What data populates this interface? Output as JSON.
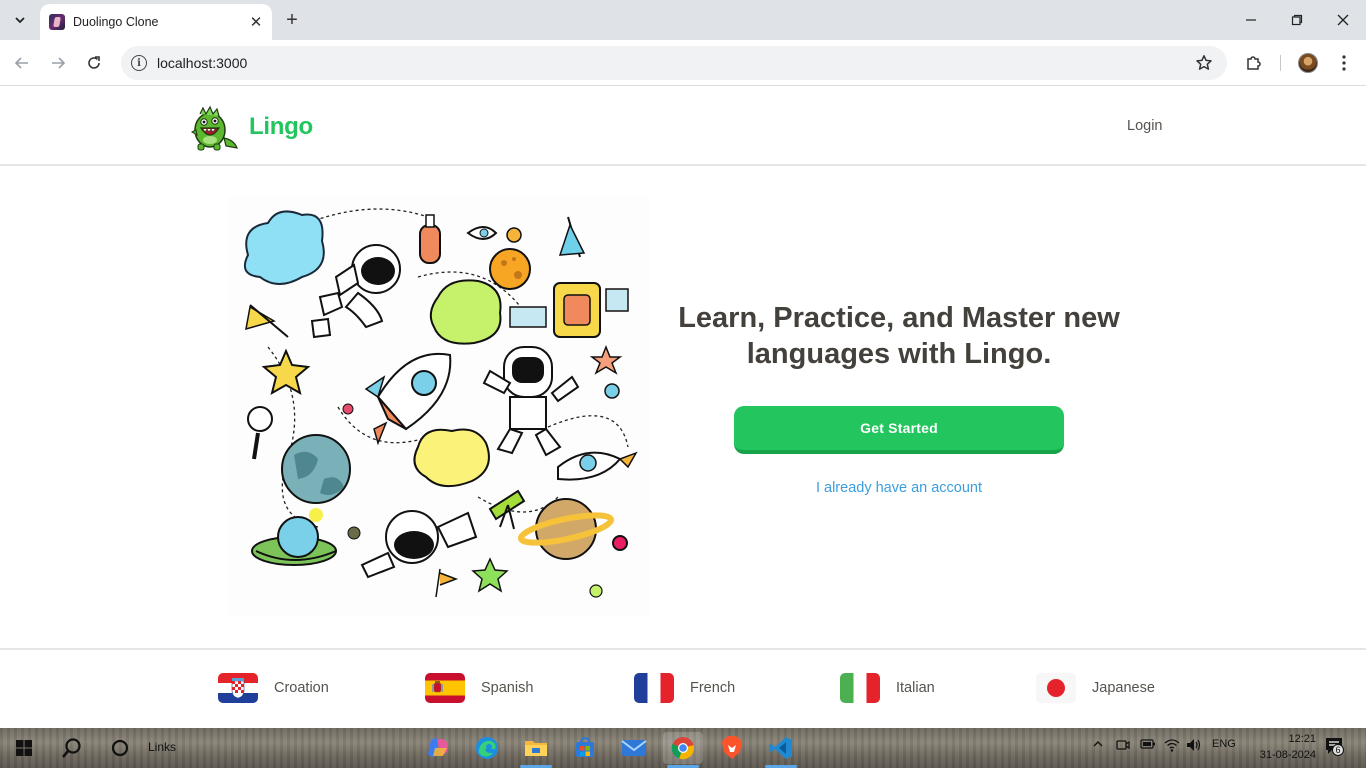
{
  "browser": {
    "tab_title": "Duolingo Clone",
    "url": "localhost:3000"
  },
  "header": {
    "brand": "Lingo",
    "login": "Login"
  },
  "hero": {
    "title": "Learn, Practice, and Master new languages with Lingo.",
    "get_started": "Get Started",
    "have_account": "I already have an account"
  },
  "languages": [
    {
      "label": "Croation",
      "flag": "croatia-flag-icon"
    },
    {
      "label": "Spanish",
      "flag": "spain-flag-icon"
    },
    {
      "label": "French",
      "flag": "france-flag-icon"
    },
    {
      "label": "Italian",
      "flag": "italy-flag-icon"
    },
    {
      "label": "Japanese",
      "flag": "japan-flag-icon"
    }
  ],
  "taskbar": {
    "search_label": "Links",
    "language": "ENG",
    "time": "12:21",
    "date": "31-08-2024",
    "notifications": "6"
  },
  "colors": {
    "brand_green": "#22c55e",
    "link_blue": "#3b9ede",
    "text_dark": "#44403c"
  }
}
